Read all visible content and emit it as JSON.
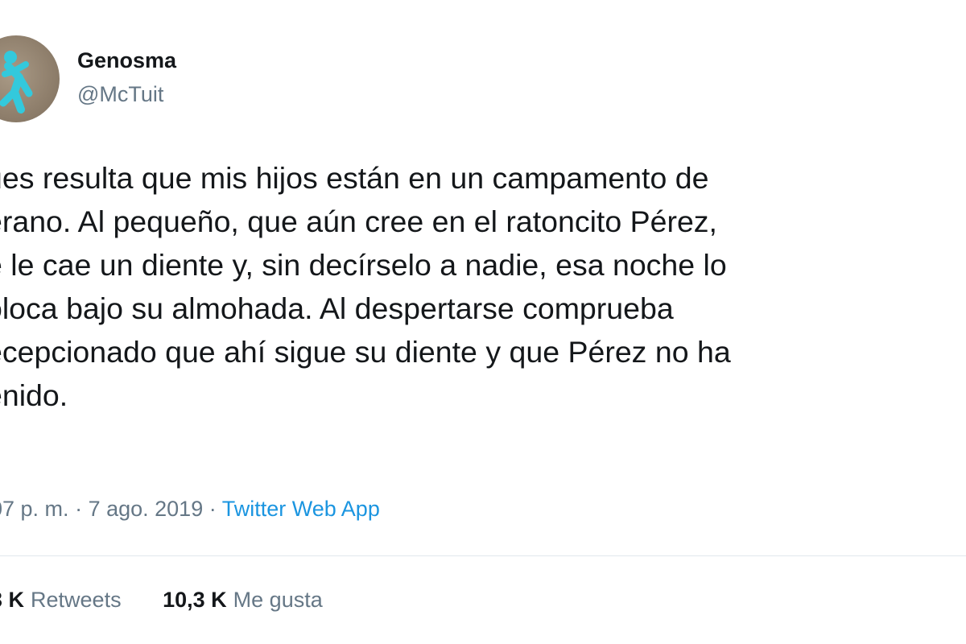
{
  "author": {
    "display_name": "Genosma",
    "handle": "@McTuit",
    "avatar_icon": "running-figure-icon",
    "avatar_accent": "#33c9dc"
  },
  "tweet": {
    "lines": [
      "ues resulta que mis hijos están en un campamento de",
      "erano. Al pequeño, que aún cree en el ratoncito Pérez,",
      "e le cae un diente y, sin decírselo a nadie, esa noche lo",
      "oloca bajo su almohada. Al despertarse comprueba",
      "ecepcionado que ahí sigue su diente y que Pérez no ha",
      "enido."
    ]
  },
  "meta": {
    "time": "07 p. m.",
    "separator": "·",
    "date": "7 ago. 2019",
    "source": "Twitter Web App"
  },
  "stats": {
    "retweets_count": "3 K",
    "retweets_label": "Retweets",
    "likes_count": "10,3 K",
    "likes_label": "Me gusta"
  },
  "colors": {
    "text": "#14171a",
    "secondary": "#657786",
    "link": "#1b95e0",
    "divider": "#e1e8ed"
  }
}
